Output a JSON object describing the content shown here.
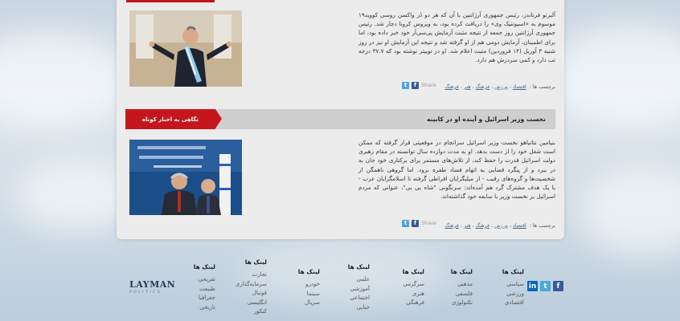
{
  "posts": [
    {
      "body": "آلبرتو فرناندز، رئیس جمهوری آرژانتین با آن که هر دو دُز واکسن روسی کووید۱۹ موسوم به «اسپوتنیک وی» را دریافت کرده بود، به ویروس کرونا دچار شد. رئیس جمهوری آرژانتین روز جمعه از نتیجه مثبت آزمایش پی‌سی‌آر خود خبر داده بود، اما برای اطمینان، آزمایش دومی هم از او گرفته شد و نتیجه این آزمایش او نیز در روز شنبه ۳ آوریل (۱۴ فروردین) مثبت اعلام شد. او در توییتر نوشته بود که ۳۷.۷ درجه تب دارد و کمی سردرش هم دارد.",
      "tags_label": "برچسب ها :",
      "tags": [
        "اقتصاد",
        "ورزش",
        "فرهنگ",
        "هنر",
        "فرهنگ"
      ],
      "share_label": "Share"
    },
    {
      "body": "بنیامین نتانیاهو نخست وزیر اسرائیل سرانجام در موقعیتی قرار گرفته که ممکن است شغل خود را از دست بدهد. او به مدت دوازده سال توانسته در مقام رهبری دولت اسرائیل قدرت را حفظ کند، از تلاش‌های مستمر برای برکناری خود جان به در ببرد و از پیگرد قضایی به اتهام فساد طفره برود. اما گروهی ناهمگن از شخصیت‌ها و گروه‌های رقیب - از میلیگرایان افراطی گرفته تا اسلامگرایان عرب - با یک هدف مشترک گرد هم آمده‌اند: سرنگونی \"شاه بی بی\"، عنوانی که مردم اسرائیل بر نخست وزیر با سابقه خود گذاشته‌اند.",
      "tags_label": "برچسب ها :",
      "tags": [
        "اقتصاد",
        "ورزش",
        "فرهنگ",
        "هنر",
        "فرهنگ"
      ],
      "share_label": "Share"
    }
  ],
  "section": {
    "label": "نگاهی به اخبار کوتاه",
    "title": "نخست وزیر اسرائیل و آینده او در کابینه"
  },
  "footer": {
    "logo": {
      "name": "LAYMAN",
      "sub": "POLITICS"
    },
    "columns": [
      {
        "heading": "لینک ها",
        "links": [
          "سیاسی",
          "ورزشی",
          "اقتصادی"
        ]
      },
      {
        "heading": "لینک ها",
        "links": [
          "مذهبی",
          "فلسفی",
          "تکنولوژی"
        ]
      },
      {
        "heading": "لینک ها",
        "links": [
          "سرگرمی",
          "هنری",
          "فرهنگی"
        ]
      },
      {
        "heading": "لینک ها",
        "links": [
          "علمی",
          "آموزشی",
          "اجتماعی",
          "جنایی"
        ]
      },
      {
        "heading": "لینک ها",
        "links": [
          "خودرو",
          "سینما",
          "سریال"
        ]
      },
      {
        "heading": "لینک ها",
        "links": [
          "تجارت",
          "سرمایه‌گذاری",
          "فوتبال",
          "انگلیسی",
          "کنکور"
        ]
      },
      {
        "heading": "لینک ها",
        "links": [
          "تفریحی",
          "طبیعت",
          "جغرافیا",
          "تاریخی"
        ]
      }
    ]
  },
  "icons": [
    "facebook-icon",
    "twitter-icon",
    "linkedin-icon"
  ]
}
